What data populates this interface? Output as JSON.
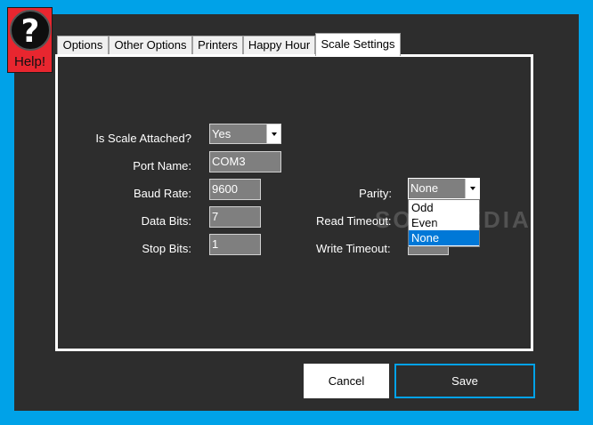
{
  "help": {
    "glyph": "?",
    "label": "Help!"
  },
  "tabs": [
    {
      "label": "Options"
    },
    {
      "label": "Other Options"
    },
    {
      "label": "Printers"
    },
    {
      "label": "Happy Hour"
    },
    {
      "label": "Scale Settings",
      "active": true
    }
  ],
  "form": {
    "scale_attached": {
      "label": "Is Scale Attached?",
      "value": "Yes"
    },
    "port_name": {
      "label": "Port Name:",
      "value": "COM3"
    },
    "baud_rate": {
      "label": "Baud Rate:",
      "value": "9600"
    },
    "data_bits": {
      "label": "Data Bits:",
      "value": "7"
    },
    "stop_bits": {
      "label": "Stop Bits:",
      "value": "1"
    },
    "parity": {
      "label": "Parity:",
      "value": "None",
      "options": [
        "Odd",
        "Even",
        "None"
      ]
    },
    "read_timeout": {
      "label": "Read Timeout:"
    },
    "write_timeout": {
      "label": "Write Timeout:"
    }
  },
  "watermark": "SOFTPEDIA",
  "buttons": {
    "cancel": "Cancel",
    "save": "Save"
  },
  "colors": {
    "background": "#00a2e8",
    "window": "#2d2d2d",
    "field": "#7f7f7f",
    "help": "#e8262f",
    "selection": "#0078d7"
  }
}
